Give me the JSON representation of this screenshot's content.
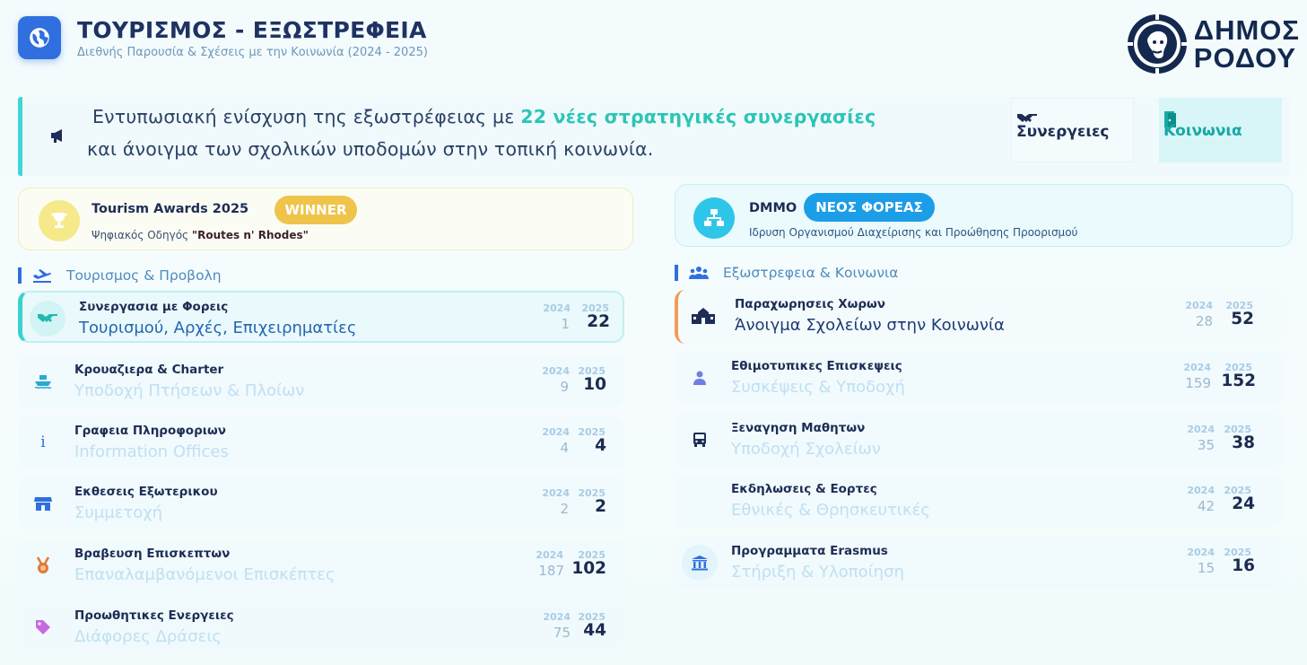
{
  "header": {
    "title": "ΤΟΥΡΙΣΜΟΣ - ΕΞΩΣΤΡΕΦΕΙΑ",
    "subtitle": "Διεθνής Παρουσία & Σχέσεις με την Κοινωνία (2024 - 2025)",
    "icon": "globe-icon",
    "accent": "#2f6fe0"
  },
  "logo": {
    "line1": "ΔΗΜΟΣ",
    "line2": "ΡΟΔΟΥ"
  },
  "banner": {
    "line1_before": "Εντυπωσιακή ενίσχυση της εξωστρέφειας με ",
    "line1_highlight": "22 νέες στρατηγικές συνεργασίες",
    "line2": "και άνοιγμα των σχολικών υποδομών στην τοπική κοινωνία.",
    "icon": "megaphone-icon",
    "highlight_color": "#2cc5b5"
  },
  "tabs": [
    {
      "label": "Συνεργειες",
      "icon": "handshake-icon",
      "active": false
    },
    {
      "label": "Κοινωνια",
      "icon": "door-icon",
      "active": true
    }
  ],
  "awards": {
    "left": {
      "title": "Tourism Awards 2025",
      "badge": "WINNER",
      "desc_before": "Ψηφιακός Οδηγός ",
      "desc_bold": "\"Routes n' Rhodes\"",
      "icon": "trophy-icon"
    },
    "right": {
      "title": "DMMO",
      "badge": "ΝΕΟΣ ΦΟΡΕΑΣ",
      "desc": "Ιδρυση Οργανισμού Διαχείρισης και Προώθησης Προορισμού",
      "icon": "org-chart-icon"
    }
  },
  "sections": {
    "left": {
      "title": "Τουρισμος & Προβολη",
      "icon": "airplane-icon"
    },
    "right": {
      "title": "Εξωστρεφεια & Κοινωνια",
      "icon": "people-icon"
    }
  },
  "year_labels": {
    "prev": "2024",
    "cur": "2025"
  },
  "left_rows": [
    {
      "title": "Συνεργασια με Φορεις",
      "sub": "Τουρισμού, Αρχές, Επιχειρηματίες",
      "prev": "1",
      "cur": "22",
      "icon": "handshake-icon"
    },
    {
      "title": "Κρουαζιερα & Charter",
      "sub": "Υποδοχή Πτήσεων & Πλοίων",
      "prev": "9",
      "cur": "10",
      "icon": "ship-icon"
    },
    {
      "title": "Γραφεια Πληροφοριων",
      "sub": "Information Offices",
      "prev": "4",
      "cur": "4",
      "icon": "info-icon"
    },
    {
      "title": "Εκθεσεις Εξωτερικου",
      "sub": "Συμμετοχή",
      "prev": "2",
      "cur": "2",
      "icon": "store-icon"
    },
    {
      "title": "Βραβευση Επισκεπτων",
      "sub": "Επαναλαμβανόμενοι Επισκέπτες",
      "prev": "187",
      "cur": "102",
      "icon": "medal-icon"
    },
    {
      "title": "Προωθητικες Ενεργειες",
      "sub": "Διάφορες Δράσεις",
      "prev": "75",
      "cur": "44",
      "icon": "tag-icon"
    }
  ],
  "right_rows": [
    {
      "title": "Παραχωρησεις Χωρων",
      "sub": "Άνοιγμα Σχολείων στην Κοινωνία",
      "prev": "28",
      "cur": "52",
      "icon": "school-icon"
    },
    {
      "title": "Εθιμοτυπικες Επισκεψεις",
      "sub": "Συσκέψεις & Υποδοχή",
      "prev": "159",
      "cur": "152",
      "icon": "person-icon"
    },
    {
      "title": "Ξεναγηση Μαθητων",
      "sub": "Υποδοχή Σχολείων",
      "prev": "35",
      "cur": "38",
      "icon": "bus-icon"
    },
    {
      "title": "Εκδηλωσεις & Εορτες",
      "sub": "Εθνικές & Θρησκευτικές",
      "prev": "42",
      "cur": "24",
      "icon": ""
    },
    {
      "title": "Προγραμματα Erasmus",
      "sub": "Στήριξη & Υλοποίηση",
      "prev": "15",
      "cur": "16",
      "icon": "institution-icon"
    }
  ]
}
